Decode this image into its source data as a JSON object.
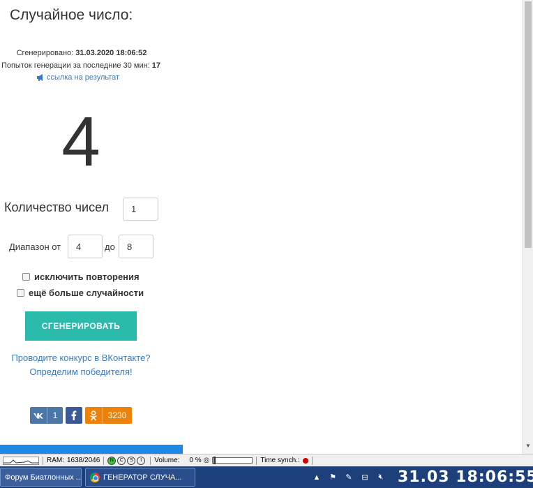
{
  "page": {
    "title": "Случайное число:",
    "generated_label": "Сгенерировано: ",
    "generated_value": "31.03.2020 18:06:52",
    "attempts_label": "Попыток генерации за последние 30 мин: ",
    "attempts_value": "17",
    "result_link": "ссылка на результат",
    "result_number": "4",
    "count_label": "Количество чисел",
    "count_value": "1",
    "range_from_label": "Диапазон от",
    "range_from_value": "4",
    "range_to_label": "до",
    "range_to_value": "8",
    "exclude_repeats_label": "исключить повторения",
    "more_random_label": "ещё больше случайности",
    "generate_button": "СГЕНЕРИРОВАТЬ",
    "vk_contest_line1": "Проводите конкурс в ВКонтакте?",
    "vk_contest_line2": "Определим победителя!"
  },
  "share": {
    "vk_count": "1",
    "ok_count": "3230"
  },
  "statusbar": {
    "ram_label": "RAM:",
    "ram_value": "1638/2046",
    "circles": [
      "N",
      "C",
      "S",
      "I"
    ],
    "volume_label": "Volume:",
    "volume_value": "0 %",
    "time_synch_label": "Time synch.:"
  },
  "taskbar": {
    "task1": "Форум Биатлонных ...",
    "task2": "ГЕНЕРАТОР СЛУЧА...",
    "clock": "31.03 18:06:55"
  },
  "colors": {
    "accent": "#2bbbad",
    "link": "#3b7bbf",
    "vk": "#4a76a8",
    "fb": "#3b5998",
    "ok": "#ee8208",
    "taskbar": "#1d3f7a"
  }
}
